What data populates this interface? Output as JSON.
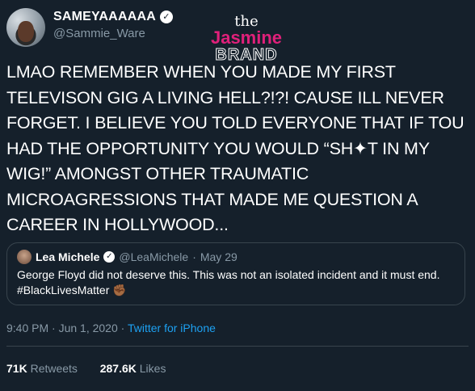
{
  "author": {
    "display_name": "SAMEYAAAAAA",
    "handle": "@Sammie_Ware"
  },
  "watermark": {
    "line1": "the",
    "line2": "Jasmine",
    "line3": "BRAND"
  },
  "tweet_text": "LMAO REMEMBER WHEN YOU MADE MY FIRST TELEVISON GIG A LIVING HELL?!?! CAUSE ILL NEVER FORGET. I BELIEVE YOU TOLD EVERYONE THAT IF TOU HAD THE OPPORTUNITY YOU WOULD “SH✦T IN MY WIG!” AMONGST OTHER TRAUMATIC MICROAGRESSIONS THAT MADE ME QUESTION A CAREER IN HOLLYWOOD...",
  "quoted_tweet": {
    "name": "Lea Michele",
    "handle": "@LeaMichele",
    "date": "May 29",
    "text": "George Floyd did not deserve this. This was not an isolated incident and it must end. #BlackLivesMatter ✊🏾"
  },
  "timestamp": "9:40 PM · Jun 1, 2020 · ",
  "source": "Twitter for iPhone",
  "stats": {
    "retweets_count": "71K",
    "retweets_label": "Retweets",
    "likes_count": "287.6K",
    "likes_label": "Likes"
  },
  "colors": {
    "background": "#15202b",
    "muted": "#8899a6",
    "link": "#1da1f2",
    "watermark_pink": "#e0207a"
  }
}
